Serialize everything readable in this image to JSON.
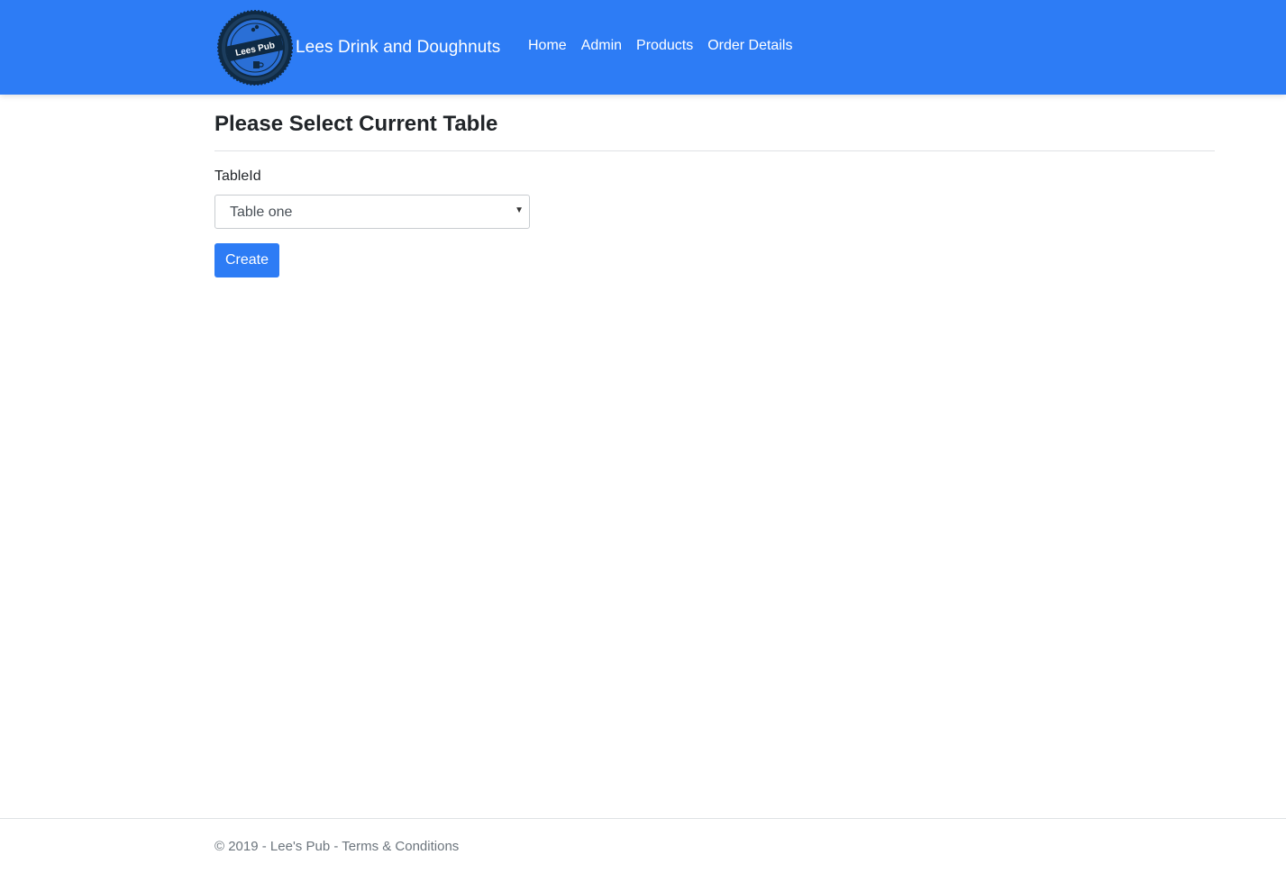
{
  "navbar": {
    "background_color": "#2d7cf5",
    "logo_text": "Lees Pub",
    "brand": "Lees Drink and Doughnuts",
    "links": [
      "Home",
      "Admin",
      "Products",
      "Order Details"
    ]
  },
  "main": {
    "title": "Please Select Current Table",
    "form": {
      "label": "TableId",
      "selected_value": "Table one",
      "submit_label": "Create"
    }
  },
  "footer": {
    "copyright": "© 2019 - Lee's Pub - ",
    "terms_link": "Terms & Conditions"
  }
}
